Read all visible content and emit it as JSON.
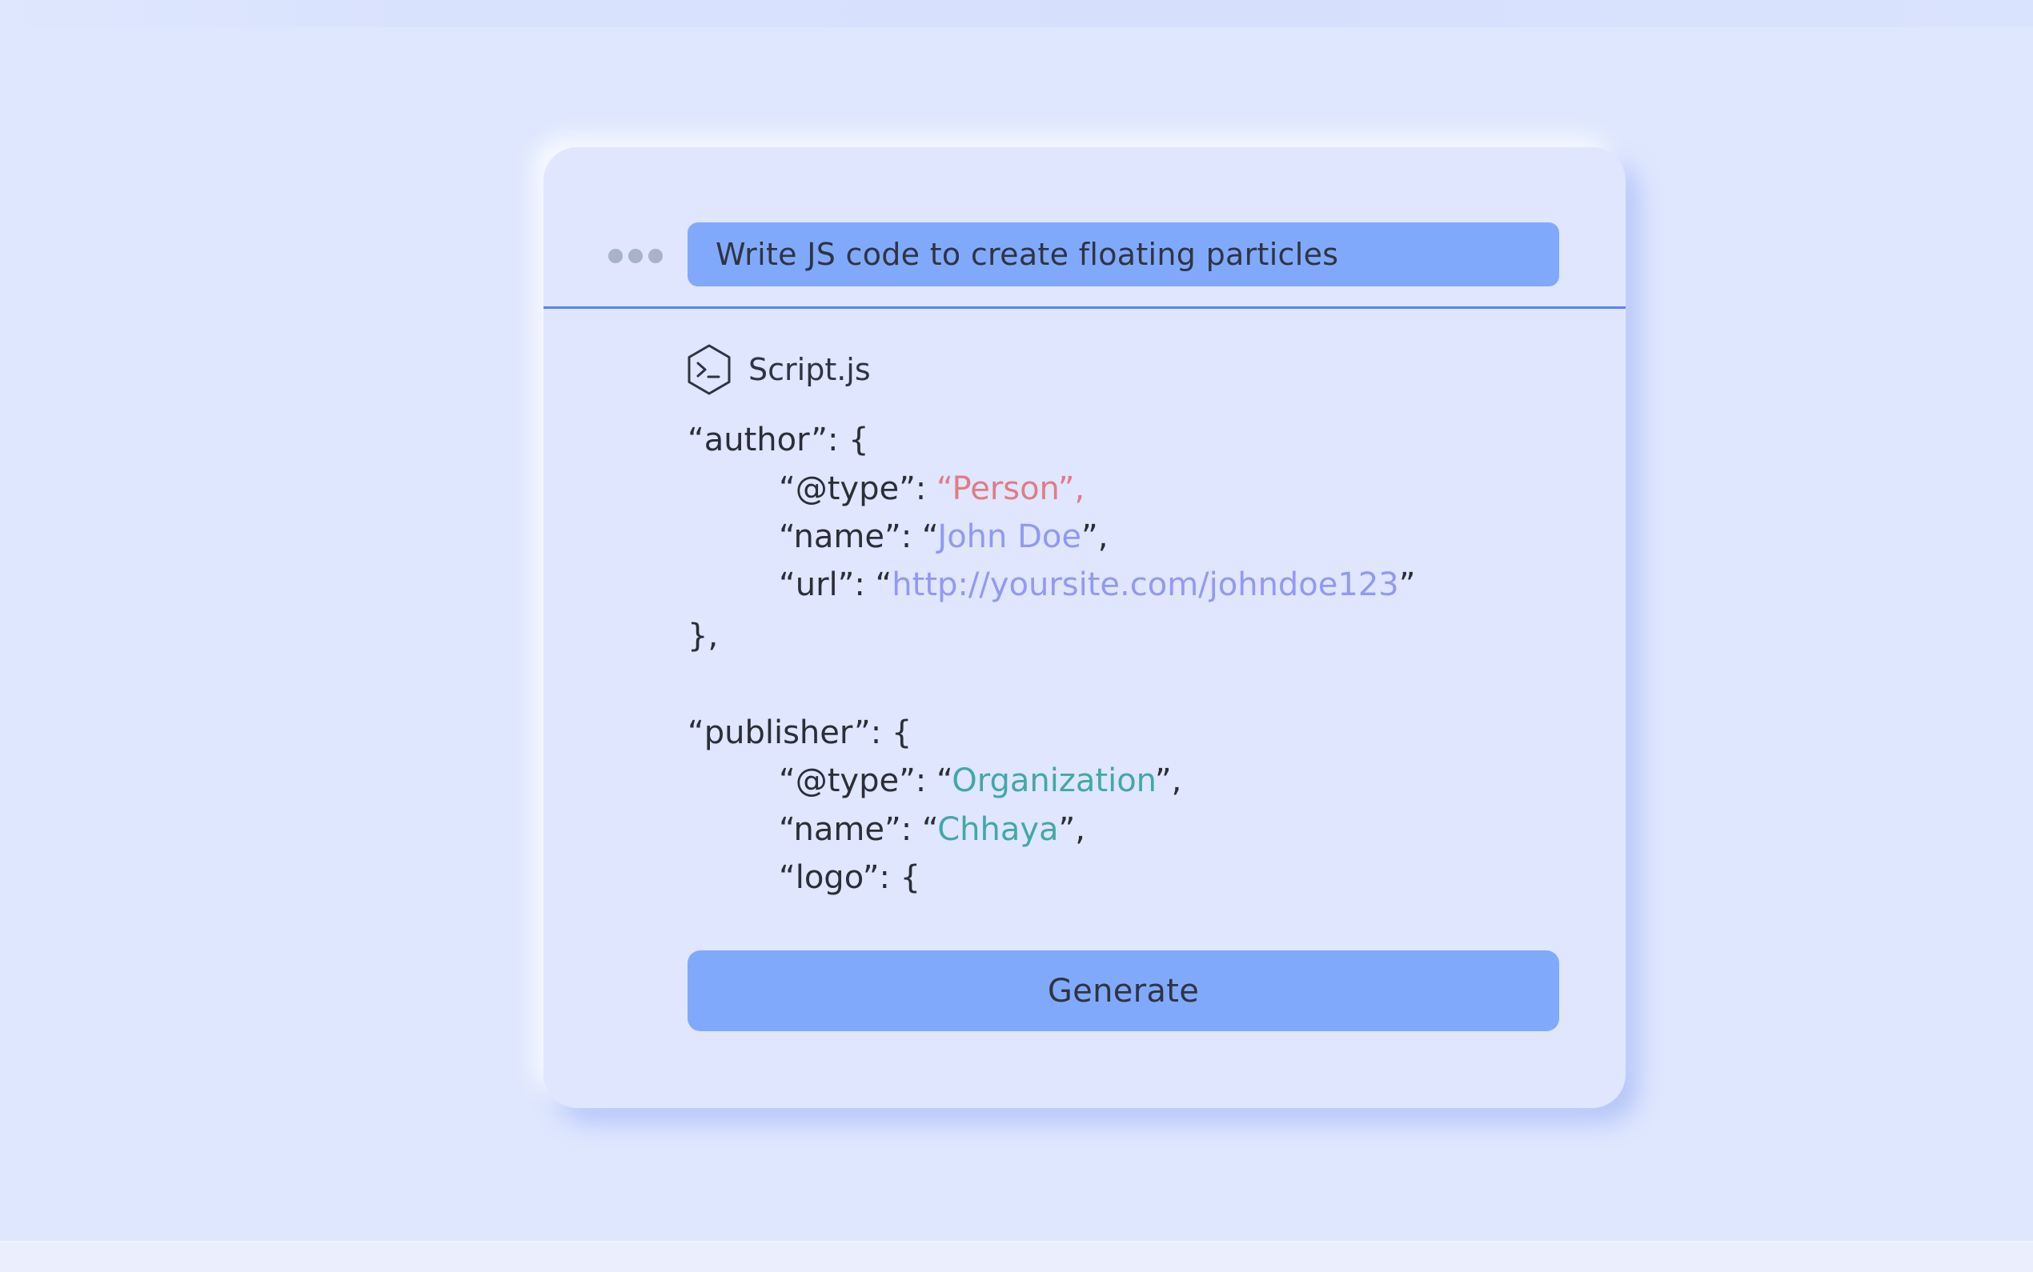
{
  "prompt": {
    "text": "Write JS code to create floating particles"
  },
  "file": {
    "name": "Script.js",
    "icon": "terminal-hexagon-icon"
  },
  "code": {
    "author_open": "“author”: {",
    "author_type_key": "“@type”: ",
    "author_type_value": "“Person”,",
    "author_name_key": "“name”: “",
    "author_name_value": "John Doe",
    "author_name_end": "”,",
    "author_url_key": "“url”: “",
    "author_url_value": "http://yoursite.com/johndoe123",
    "author_url_end": "”",
    "author_close": "},",
    "publisher_open": "“publisher”: {",
    "publisher_type_key": "“@type”: “",
    "publisher_type_value": "Organization",
    "publisher_type_end": "”,",
    "publisher_name_key": "“name”: “",
    "publisher_name_value": "Chhaya",
    "publisher_name_end": "”,",
    "publisher_logo": "“logo”: {"
  },
  "actions": {
    "generate_label": "Generate"
  },
  "colors": {
    "background": "#dfe7fe",
    "accent": "#81a9fb",
    "divider": "#5a82ee",
    "string_red": "#e07c86",
    "string_purple": "#9299f4",
    "string_teal": "#43a7a8"
  }
}
